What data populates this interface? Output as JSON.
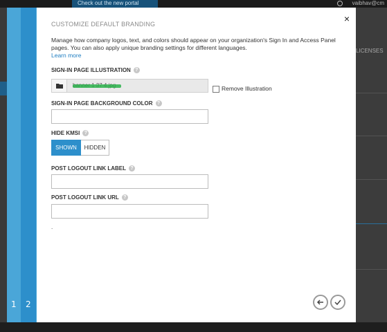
{
  "background": {
    "banner_text": "Check out the new portal",
    "user_text": "vaibhav@cm",
    "column_header": "LICENSES"
  },
  "modal": {
    "title": "CUSTOMIZE DEFAULT BRANDING",
    "description": "Manage how company logos, text, and colors should appear on your organization's Sign In and Access Panel pages. You can also apply unique branding settings for different languages.",
    "learn_more": "Learn more",
    "close_glyph": "×",
    "steps": [
      "1",
      "2"
    ],
    "fields": {
      "sign_in_illustration": {
        "label": "SIGN-IN PAGE ILLUSTRATION",
        "file_value": "banner 1 37 4.jpg",
        "remove_label": "Remove Illustration",
        "remove_checked": false
      },
      "background_color": {
        "label": "SIGN-IN PAGE BACKGROUND COLOR",
        "value": ""
      },
      "hide_kmsi": {
        "label": "HIDE KMSI",
        "options": [
          "SHOWN",
          "HIDDEN"
        ],
        "selected": "SHOWN"
      },
      "logout_label": {
        "label": "POST LOGOUT LINK LABEL",
        "value": ""
      },
      "logout_url": {
        "label": "POST LOGOUT LINK URL",
        "value": ""
      }
    },
    "trailing_text": "."
  },
  "colors": {
    "accent": "#2d8fcb",
    "strip_light": "#4aa6d8",
    "link": "#1e7dc1"
  },
  "icons": {
    "help": "question-circle-icon",
    "folder": "folder-icon",
    "back": "arrow-left-icon",
    "done": "checkmark-icon",
    "close": "close-icon"
  }
}
